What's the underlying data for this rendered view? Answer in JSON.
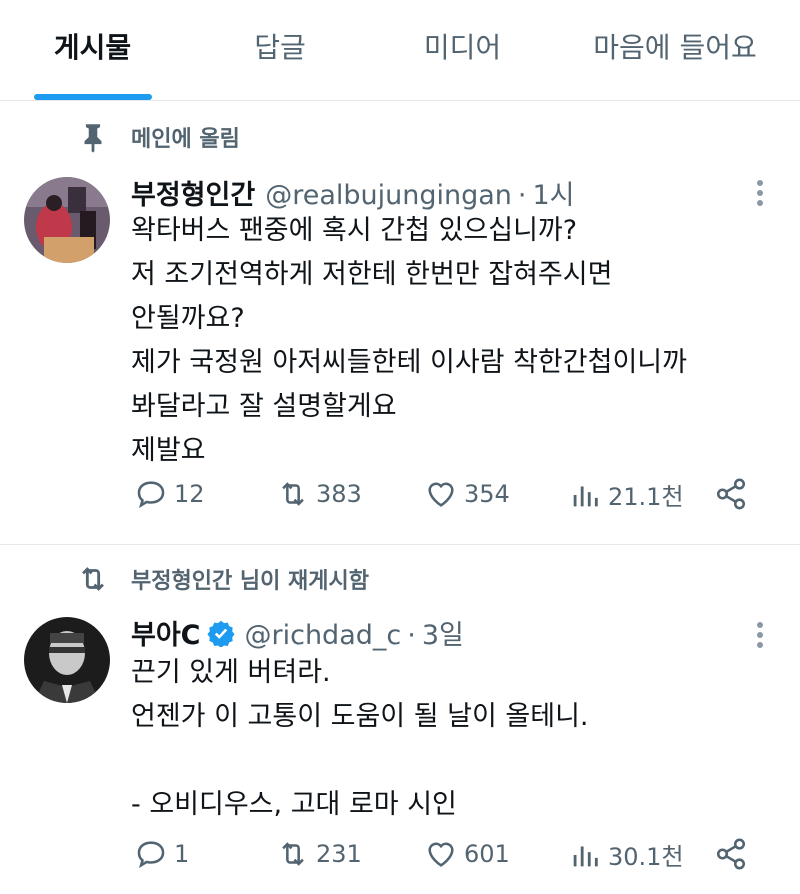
{
  "tabs": [
    {
      "label": "게시물",
      "active": true
    },
    {
      "label": "답글",
      "active": false
    },
    {
      "label": "미디어",
      "active": false
    },
    {
      "label": "마음에 들어요",
      "active": false
    }
  ],
  "posts": [
    {
      "context_icon": "pin-icon",
      "context_label": "메인에 올림",
      "name": "부정형인간",
      "verified": false,
      "handle": "@realbujungingan",
      "dot": "·",
      "time": "1시",
      "body": [
        "왁타버스 팬중에 혹시 간첩 있으십니까?",
        "저 조기전역하게 저한테 한번만 잡혀주시면",
        "안될까요?",
        "제가 국정원 아저씨들한테 이사람 착한간첩이니까",
        "봐달라고 잘 설명할게요",
        "제발요"
      ],
      "replies": "12",
      "reposts": "383",
      "likes": "354",
      "views": "21.1천"
    },
    {
      "context_icon": "repost-icon",
      "context_label": "부정형인간 님이 재게시함",
      "name": "부아C",
      "verified": true,
      "handle": "@richdad_c",
      "dot": "·",
      "time": "3일",
      "body": [
        "끈기 있게 버텨라.",
        "언젠가 이 고통이 도움이 될 날이 올테니.",
        "",
        "- 오비디우스, 고대 로마 시인"
      ],
      "replies": "1",
      "reposts": "231",
      "likes": "601",
      "views": "30.1천"
    }
  ],
  "colors": {
    "accent": "#1d9bf0",
    "text": "#0f1419",
    "secondary": "#536471",
    "divider": "#e6e9eb"
  }
}
